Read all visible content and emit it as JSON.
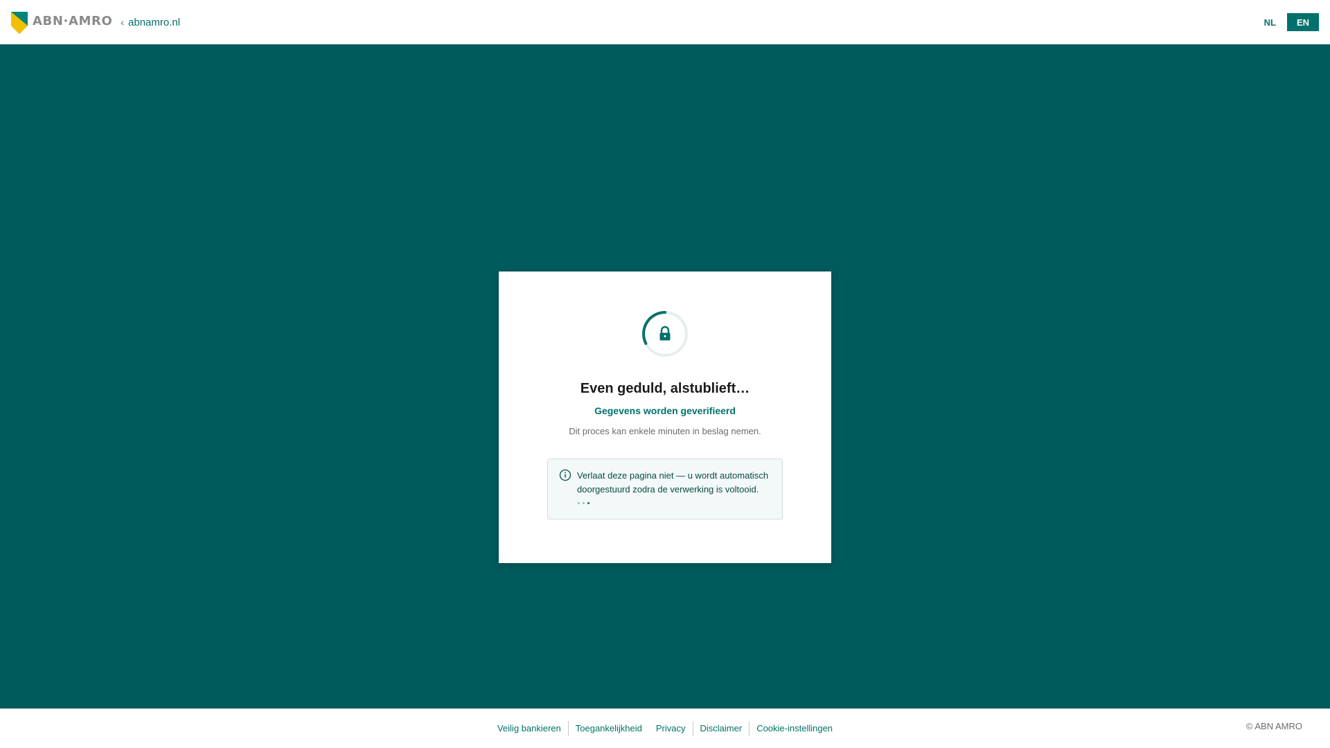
{
  "header": {
    "logo_text": "ABN·AMRO",
    "back_link": "abnamro.nl",
    "lang": {
      "nl": "NL",
      "en": "EN",
      "active": "EN"
    }
  },
  "card": {
    "title": "Even geduld, alstublieft…",
    "subtitle": "Gegevens worden geverifieerd",
    "note": "Dit proces kan enkele minuten in beslag nemen.",
    "info_text": "Verlaat deze pagina niet — u wordt automatisch doorgestuurd zodra de verwerking is voltooid.",
    "spinner_icon": "lock-icon"
  },
  "footer": {
    "links": [
      "Veilig bankieren",
      "Toegankelijkheid",
      "Privacy",
      "Disclaimer",
      "Cookie-instellingen"
    ],
    "copyright": "© ABN AMRO"
  },
  "colors": {
    "brand_green": "#00716b",
    "background_teal": "#005b5d",
    "shield_yellow": "#f3c000",
    "shield_green": "#009286"
  }
}
